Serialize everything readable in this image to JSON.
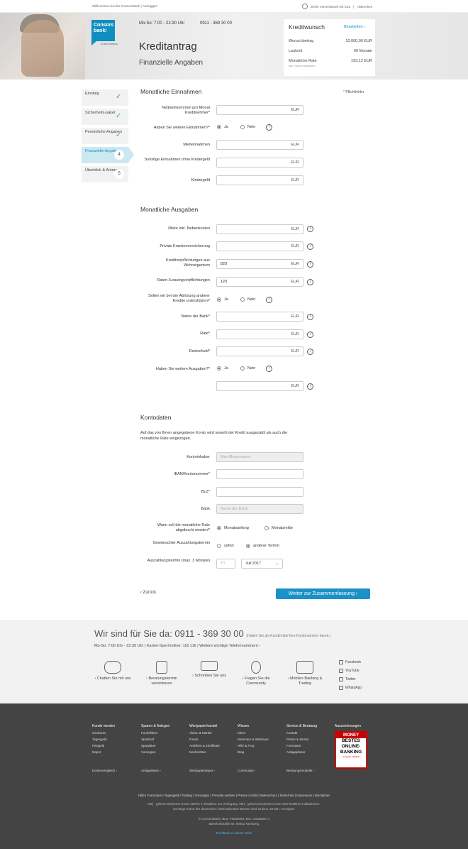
{
  "topbar": {
    "left": "Willkommen bei der Consorsbank | Ausloggen",
    "secure": "sicher verschlüsselt mit SSL",
    "cancel": "Abbrechen"
  },
  "hero": {
    "logo": "Consors bank!",
    "logo_sub": "by BNP PARIBAS",
    "hours": "Mo-So: 7:00 - 22:30 Uhr",
    "phone": "0911 - 369 30 00",
    "title": "Kreditantrag",
    "subtitle": "Finanzielle Angaben"
  },
  "kreditwunsch": {
    "heading": "Kreditwunsch",
    "edit": "Bearbeiten ›",
    "rows": [
      {
        "label": "Wunschbetrag",
        "value": "10.000,00 EUR"
      },
      {
        "label": "Laufzeit",
        "value": "60 Monate"
      },
      {
        "label": "Monatliche Rate",
        "value": "193,12 EUR"
      }
    ],
    "note": "inkl. Sicherheitspaket"
  },
  "steps": [
    {
      "label": "Einstieg",
      "state": "done"
    },
    {
      "label": "Sicherheits-paket",
      "state": "done"
    },
    {
      "label": "Persönliche Angaben",
      "state": "done"
    },
    {
      "label": "Finanzielle Angaben",
      "num": "4",
      "state": "active"
    },
    {
      "label": "Überblick & Antrag",
      "num": "5",
      "state": "todo"
    }
  ],
  "required_note": "* Pflichtfelder",
  "einnahmen": {
    "heading": "Monatliche Einnahmen",
    "netto_label": "Nettoeinkommen pro Monat Kreditnehmer*",
    "weitere_label": "Haben Sie weitere Einnahmen?*",
    "ja": "Ja",
    "nein": "Nein",
    "miete_label": "Mieteinnahmen",
    "sonstige_label": "Sonstige Einnahmen ohne Kindergeld",
    "kindergeld_label": "Kindergeld",
    "unit": "EUR"
  },
  "ausgaben": {
    "heading": "Monatliche Ausgaben",
    "miete_label": "Miete inkl. Nebenkosten",
    "kv_label": "Private Krankenversicherung",
    "kredit_label": "Kreditverpflichtungen aus Wohneigentum",
    "kredit_value": "820",
    "raten_label": "Raten-/Leasingverpflichtungen",
    "raten_value": "120",
    "abloesung_label": "Sollen wir bei der Ablösung anderer Kredite unterstützen?",
    "bank_label": "Name der Bank*",
    "rate_label": "Rate*",
    "rest_label": "Restschuld*",
    "weitere_label": "Haben Sie weitere Ausgaben?*"
  },
  "konto": {
    "heading": "Kontodaten",
    "intro": "Auf das von Ihnen angegebene Konto wird sowohl der Kredit ausgezahlt als auch die monatliche Rate eingezogen.",
    "inhaber_label": "Kontoinhaber",
    "inhaber_value": "Max Mustermann",
    "iban_label": "IBAN/Kontonummer*",
    "blz_label": "BLZ*",
    "bank_label": "Bank",
    "bank_placeholder": "Name der Bank",
    "abbuch_label": "Wann soll die monatliche Rate abgebucht werden?",
    "monatsanfang": "Monatsanfang",
    "monatsmitte": "Monatsmitte",
    "auszahl_label": "Gewünschter Auszahlungstermin",
    "sofort": "sofort",
    "anderer": "anderer Termin",
    "termin_label": "Auszahlungstermin (max. 3 Monate)",
    "tt": "TT",
    "monat": "Juli 2017"
  },
  "nav": {
    "back": "‹ Zurück",
    "next": "Weiter zur Zusammenfassung ›"
  },
  "contact": {
    "big": "Wir sind für Sie da: 0911 - 369 30 00",
    "big_note": "(Halten Sie als Kunde bitte Ihre Kontonummer bereit.)",
    "small": "Mo-So: 7:00 Uhr - 22:30 Uhr  |  Karten-Sperrhotline: 116 116  |  Weitere wichtige Telefonnummern ›",
    "channels": [
      "› Chatten Sie mit uns",
      "› Beratungstermin vereinbaren",
      "› Schreiben Sie uns",
      "› Fragen Sie die Community",
      "› Mobiles Banking & Trading"
    ],
    "social": [
      "Facebook",
      "YouTube",
      "Twitter",
      "WhatsApp"
    ]
  },
  "footer": {
    "cols": [
      {
        "head": "Kunde werden",
        "items": [
          "Girokonto",
          "Tagesgeld",
          "Festgeld",
          "Depot"
        ],
        "more": "Kontenvergleich ›"
      },
      {
        "head": "Sparen & Anlegen",
        "items": [
          "Fondsfilters",
          "Sparbrief",
          "Sparpläne",
          "Vorsorgen"
        ],
        "more": "Anlageideen ›"
      },
      {
        "head": "Wertpapierhandel",
        "items": [
          "Aktien & Märkte",
          "Fonds",
          "Anleihen & Zertifikate",
          "Nachrichten"
        ],
        "more": "Wertpapierdepot ›"
      },
      {
        "head": "Wissen",
        "items": [
          "Ideen",
          "Seminare & Webinare",
          "Hilfe & FAQ",
          "Blog"
        ],
        "more": "Community ›"
      },
      {
        "head": "Service & Beratung",
        "items": [
          "Kontakt",
          "Preise & Zinsen",
          "Formulare",
          "Anlageplaner"
        ],
        "more": "Beratungsmodelle ›"
      },
      {
        "head": "Auszeichnungen",
        "items": [],
        "more": ""
      }
    ],
    "badge_top": "MONEY",
    "badge_main": "BESTES ONLINE-BANKING",
    "badge_sub": "Ausgabe 10/2016",
    "links": "Hilfe | Formulare | Tagesgeld | Trading | Vorsorgen | Freunde werben | Presse | AGB | Datenschutz | Sicherheit | Impressum | Disclaimer",
    "note1": "Mit ⎸gekennzeichnete Kurse stehen in Realtime zur Verfügung. Mit ⎸gekennzeichnete Kurse sind Realtime-Indikationen.",
    "note2": "Sonstige Kurse der deutschen / internationalen Börsen sind 15 bzw. 20 Min. verzögert.",
    "address1": "© Consorsbank, BLZ: 76030080, BIC: CSDBDE71",
    "address2": "Bahnhofstraße 55, 90402 Nürnberg",
    "feedback": "Feedback zu dieser Seite"
  }
}
